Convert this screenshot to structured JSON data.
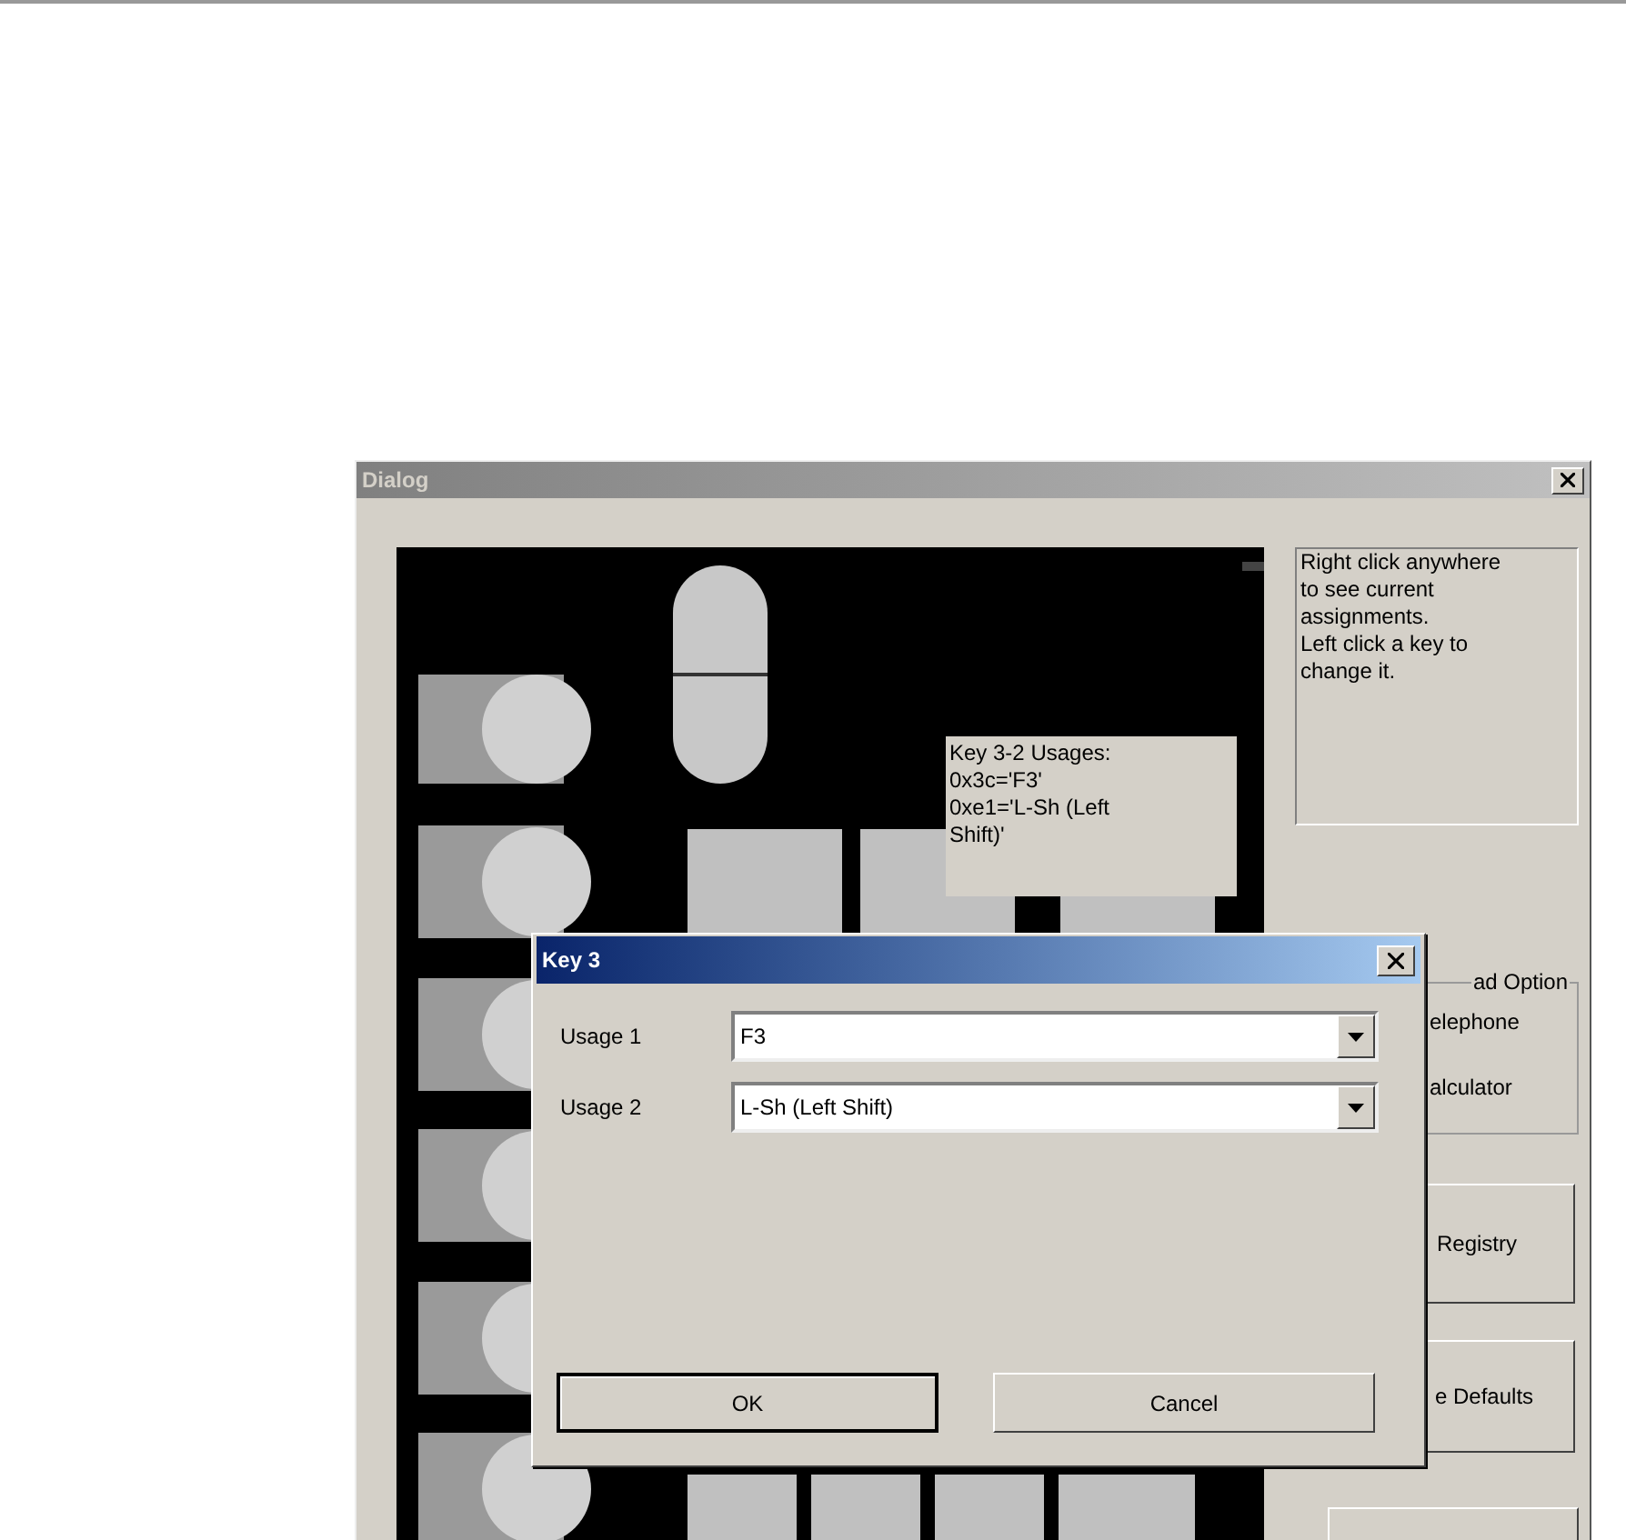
{
  "window": {
    "title": "Dialog"
  },
  "info_text": "Right click anywhere\nto see current\nassignments.\nLeft click a key to\nchange it.",
  "tooltip": "Key 3-2 Usages:\n0x3c='F3'\n0xe1='L-Sh (Left\nShift)'",
  "option_group": {
    "label": "ad Option",
    "options": [
      "elephone",
      "alculator"
    ]
  },
  "side_buttons": [
    "Registry",
    "e Defaults"
  ],
  "key_dialog": {
    "title": "Key 3",
    "fields": [
      {
        "label": "Usage 1",
        "value": "F3"
      },
      {
        "label": "Usage 2",
        "value": "L-Sh (Left Shift)"
      }
    ],
    "buttons": [
      {
        "label": "OK",
        "default": true
      },
      {
        "label": "Cancel",
        "default": false
      }
    ]
  }
}
